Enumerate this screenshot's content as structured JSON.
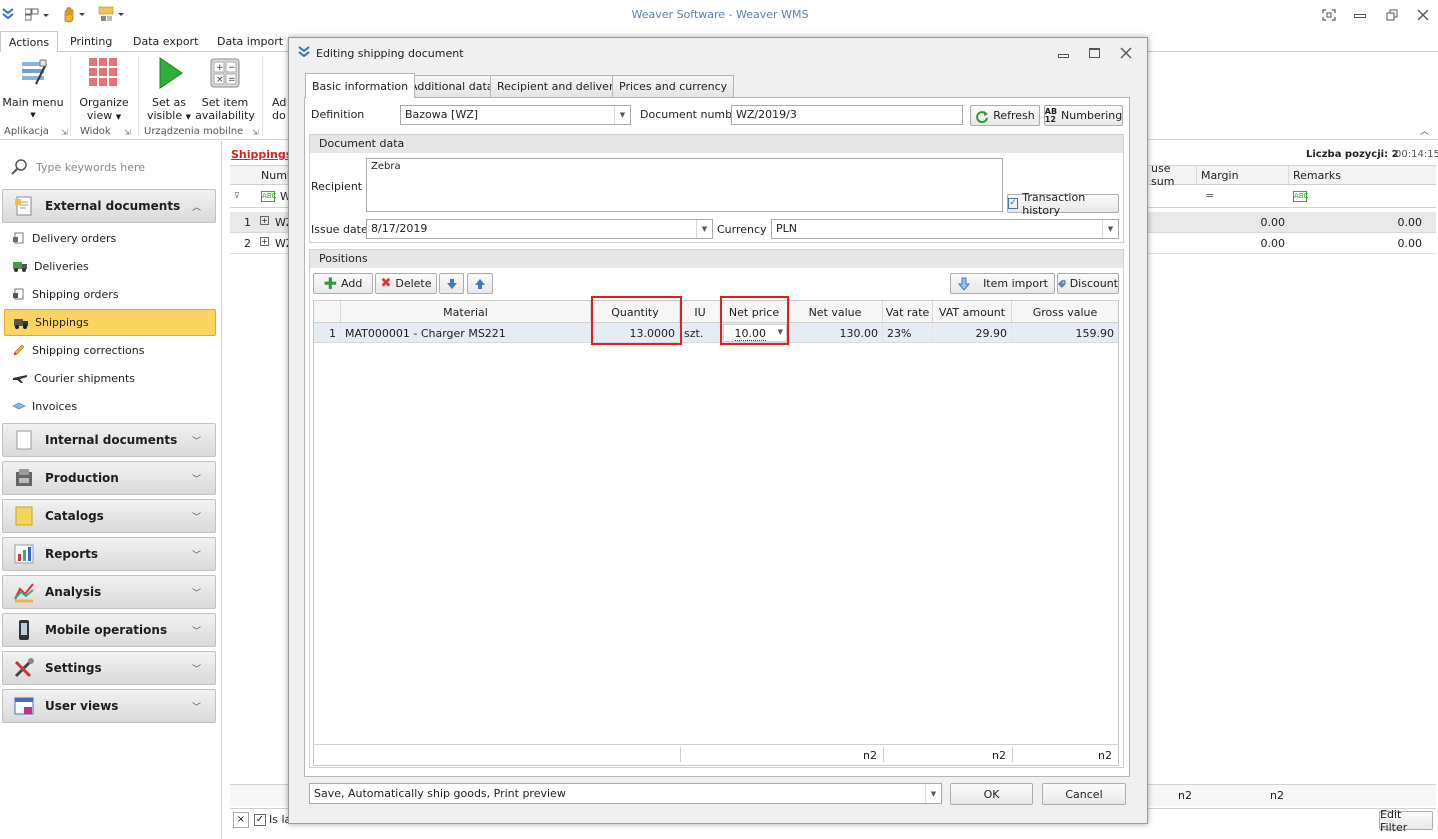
{
  "window": {
    "title": "Weaver Software - Weaver WMS"
  },
  "ribbon": {
    "tabs": [
      "Actions",
      "Printing",
      "Data export",
      "Data import"
    ],
    "buttons": {
      "main_menu": "Main menu",
      "organize_view_1": "Organize",
      "organize_view_2": "view",
      "set_visible_1": "Set as",
      "set_visible_2": "visible",
      "set_item_1": "Set item",
      "set_item_2": "availability",
      "add_partial_1": "Ad",
      "add_partial_2": "do"
    },
    "groups": [
      "Aplikacja",
      "Widok",
      "Urządzenia mobilne"
    ]
  },
  "sidebar": {
    "search_placeholder": "Type keywords here",
    "external_group": "External documents",
    "items": [
      "Delivery orders",
      "Deliveries",
      "Shipping orders",
      "Shippings",
      "Shipping corrections",
      "Courier shipments",
      "Invoices"
    ],
    "groups": [
      "Internal documents",
      "Production",
      "Catalogs",
      "Reports",
      "Analysis",
      "Mobile operations",
      "Settings",
      "User views"
    ]
  },
  "background": {
    "breadcrumb": "Shippings",
    "count_label": "Liczba pozycji: 2",
    "timer": "00:14:15",
    "col_number_partial": "Numb",
    "col_use_sum_partial": "use sum",
    "col_margin": "Margin",
    "col_remarks": "Remarks",
    "filter_w": "W",
    "filter_eq": "=",
    "rows": [
      {
        "n": "1",
        "doc": "WZ",
        "sum": "0.00",
        "margin": "0.00"
      },
      {
        "n": "2",
        "doc": "WZ",
        "sum": "0.00",
        "margin": "0.00"
      }
    ],
    "footer_n2_a": "n2",
    "footer_n2_b": "n2",
    "is_label_partial": "Is la",
    "edit_filter": "Edit Filter"
  },
  "dialog": {
    "title": "Editing shipping document",
    "tabs": [
      "Basic information",
      "Additional data",
      "Recipient and delivery",
      "Prices and currency"
    ],
    "definition_label": "Definition",
    "definition_value": "Bazowa [WZ]",
    "docnum_label": "Document number",
    "docnum_value": "WZ/2019/3",
    "refresh_label": "Refresh",
    "numbering_label": "Numbering",
    "docdata_header": "Document data",
    "recipient_label": "Recipient",
    "recipient_value": "Zebra",
    "transaction_history": "Transaction history",
    "issue_date_label": "Issue date",
    "issue_date_value": "8/17/2019",
    "currency_label": "Currency",
    "currency_value": "PLN",
    "positions_header": "Positions",
    "add_label": "Add",
    "delete_label": "Delete",
    "item_import_label": "Item import",
    "discount_label": "Discount",
    "grid_headers": [
      "Material",
      "Quantity",
      "IU",
      "Net price",
      "Net value",
      "Vat rate",
      "VAT amount",
      "Gross value"
    ],
    "grid_row": {
      "n": "1",
      "material": "MAT000001 - Charger MS221",
      "quantity": "13.0000",
      "iu": "szt.",
      "net_price": "10.00",
      "net_value": "130.00",
      "vat_rate": "23%",
      "vat_amount": "29.90",
      "gross_value": "159.90"
    },
    "footer_n2": [
      "n2",
      "n2",
      "n2"
    ],
    "save_option": "Save, Automatically ship goods, Print preview",
    "ok_label": "OK",
    "cancel_label": "Cancel"
  },
  "colors": {
    "highlight_red": "#e0201c",
    "selected_nav": "#fbd463",
    "accent_blue": "#2f6fbd"
  }
}
